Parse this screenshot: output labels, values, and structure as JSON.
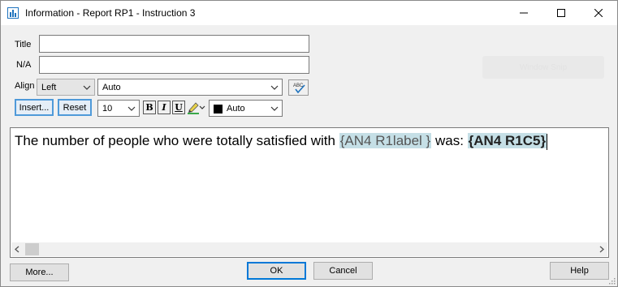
{
  "window": {
    "title": "Information - Report RP1 - Instruction 3"
  },
  "form": {
    "title_label": "Title",
    "title_value": "",
    "na_label": "N/A",
    "na_value": "",
    "align_label": "Align",
    "align_value": "Left",
    "auto_value": "Auto",
    "spellcheck_icon_text": "ABC",
    "insert_label": "Insert...",
    "reset_label": "Reset",
    "font_size_value": "10",
    "bold_label": "B",
    "italic_label": "I",
    "underline_label": "U",
    "color_value": "Auto"
  },
  "ghost_label": "Window Snip",
  "editor": {
    "text_before": "The number of people who were totally satisfied with ",
    "field1": "{AN4 R1label }",
    "text_middle": " was: ",
    "field2": "{AN4 R1C5}"
  },
  "footer": {
    "more_label": "More...",
    "ok_label": "OK",
    "cancel_label": "Cancel",
    "help_label": "Help"
  },
  "colors": {
    "accent_border": "#4f9ad9",
    "field_highlight": "#c5dfe6",
    "default_button_border": "#0078d7"
  }
}
